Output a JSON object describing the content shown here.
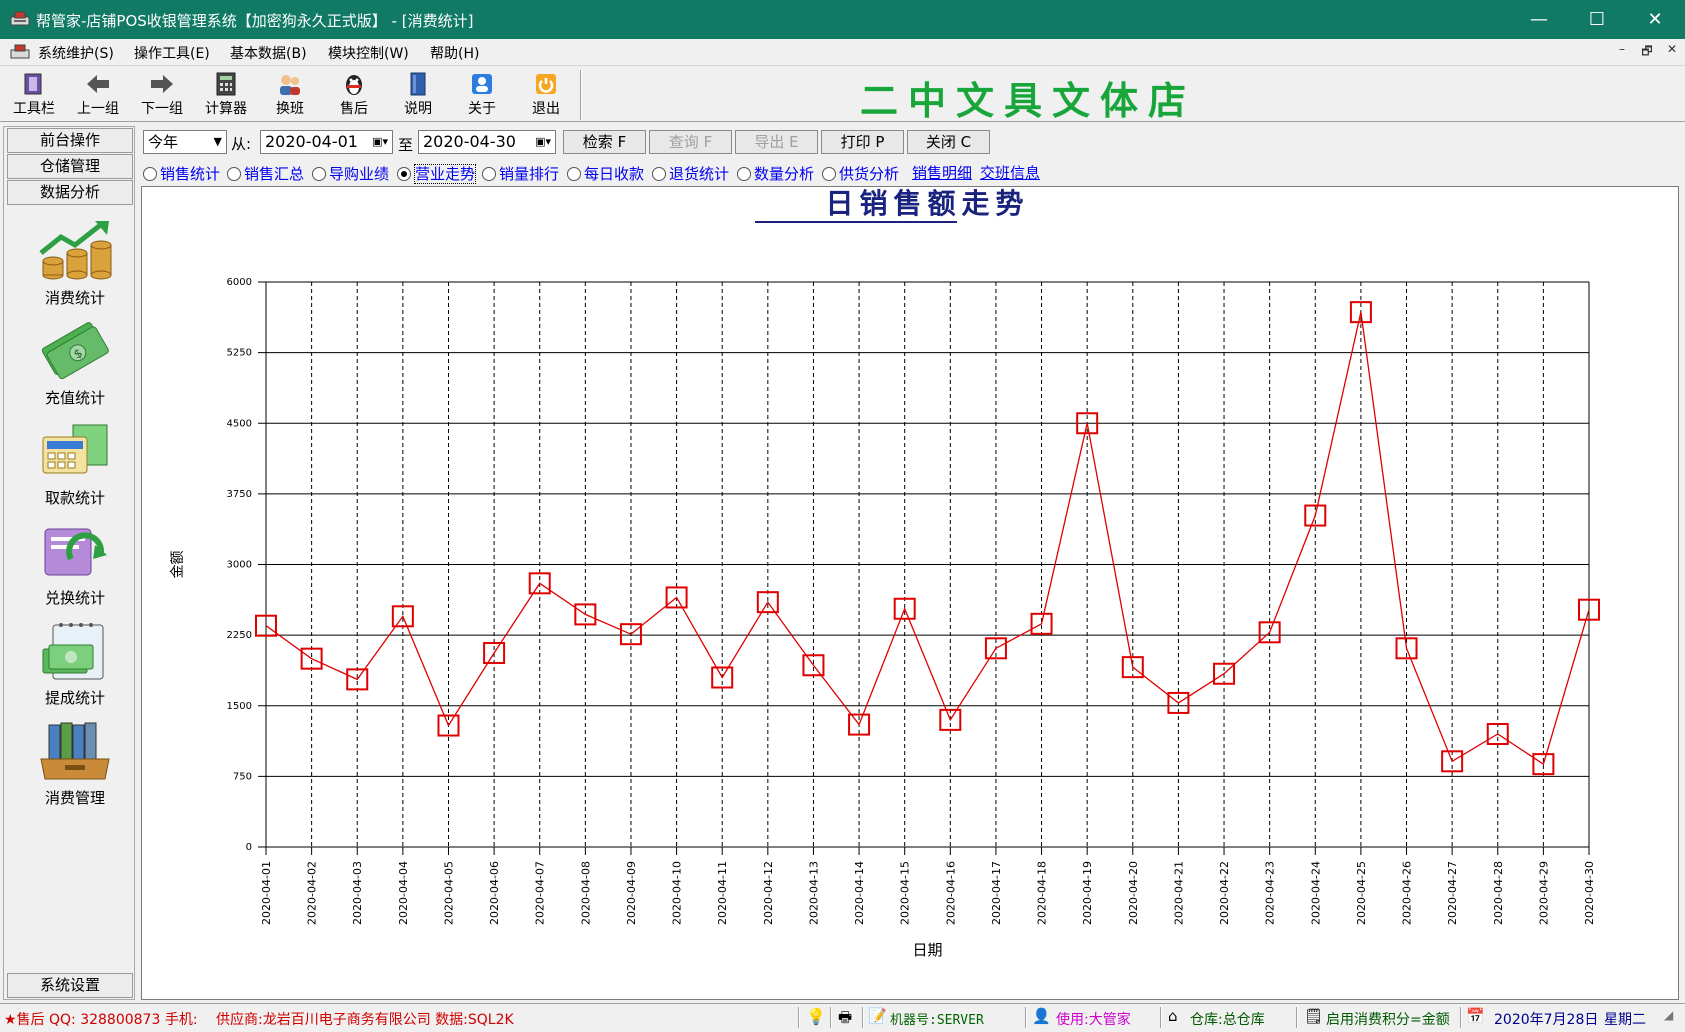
{
  "window": {
    "title": "帮管家-店铺POS收银管理系统【加密狗永久正式版】 - [消费统计]",
    "minimize": "—",
    "maximize": "☐",
    "close": "✕"
  },
  "menu": {
    "items": [
      "系统维护(S)",
      "操作工具(E)",
      "基本数据(B)",
      "模块控制(W)",
      "帮助(H)"
    ],
    "mdi_min": "–",
    "mdi_restore": "🗗",
    "mdi_close": "✕"
  },
  "toolbar": {
    "buttons": [
      "工具栏",
      "上一组",
      "下一组",
      "计算器",
      "换班",
      "售后",
      "说明",
      "关于",
      "退出"
    ]
  },
  "store_name": "二中文具文体店",
  "sidebar": {
    "tabs": [
      "前台操作",
      "仓储管理",
      "数据分析"
    ],
    "items": [
      "消费统计",
      "充值统计",
      "取款统计",
      "兑换统计",
      "提成统计",
      "消费管理"
    ],
    "bottom_tab": "系统设置"
  },
  "filter": {
    "period": "今年",
    "from_label": "从:",
    "from_date": "2020-04-01",
    "to_label": "至",
    "to_date": "2020-04-30",
    "buttons": [
      "检索 F",
      "查询 F",
      "导出 E",
      "打印 P",
      "关闭 C"
    ]
  },
  "radios": {
    "items": [
      "销售统计",
      "销售汇总",
      "导购业绩",
      "营业走势",
      "销量排行",
      "每日收款",
      "退货统计",
      "数量分析",
      "供货分析"
    ],
    "selected": "营业走势",
    "links": [
      "销售明细",
      "交班信息"
    ]
  },
  "status": {
    "support": "★售后 QQ: 328800873 手机:",
    "supplier": "供应商:龙岩百川电子商务有限公司 数据:SQL2K",
    "machine": "机器号:SERVER",
    "user": "使用:大管家",
    "warehouse": "仓库:总仓库",
    "points": "启用消费积分=金额",
    "date": "2020年7月28日",
    "weekday": "星期二"
  },
  "colors": {
    "titlebar": "#117a65",
    "series": "#e00000",
    "store_name": "#18a63a",
    "link": "#0000ee"
  },
  "chart_data": {
    "type": "line",
    "title": "日销售额走势",
    "xlabel": "日期",
    "ylabel": "金额",
    "ylim": [
      0,
      6000
    ],
    "yticks": [
      0,
      750,
      1500,
      2250,
      3000,
      3750,
      4500,
      5250,
      6000
    ],
    "grid": true,
    "marker": "square",
    "x": [
      "2020-04-01",
      "2020-04-02",
      "2020-04-03",
      "2020-04-04",
      "2020-04-05",
      "2020-04-06",
      "2020-04-07",
      "2020-04-08",
      "2020-04-09",
      "2020-04-10",
      "2020-04-11",
      "2020-04-12",
      "2020-04-13",
      "2020-04-14",
      "2020-04-15",
      "2020-04-16",
      "2020-04-17",
      "2020-04-18",
      "2020-04-19",
      "2020-04-20",
      "2020-04-21",
      "2020-04-22",
      "2020-04-23",
      "2020-04-24",
      "2020-04-25",
      "2020-04-26",
      "2020-04-27",
      "2020-04-28",
      "2020-04-29",
      "2020-04-30"
    ],
    "values": [
      2350,
      2000,
      1780,
      2450,
      1290,
      2060,
      2800,
      2470,
      2260,
      2650,
      1800,
      2600,
      1930,
      1300,
      2530,
      1350,
      2110,
      2370,
      4500,
      1910,
      1530,
      1840,
      2280,
      3520,
      5680,
      2110,
      910,
      1200,
      880,
      2520
    ]
  }
}
